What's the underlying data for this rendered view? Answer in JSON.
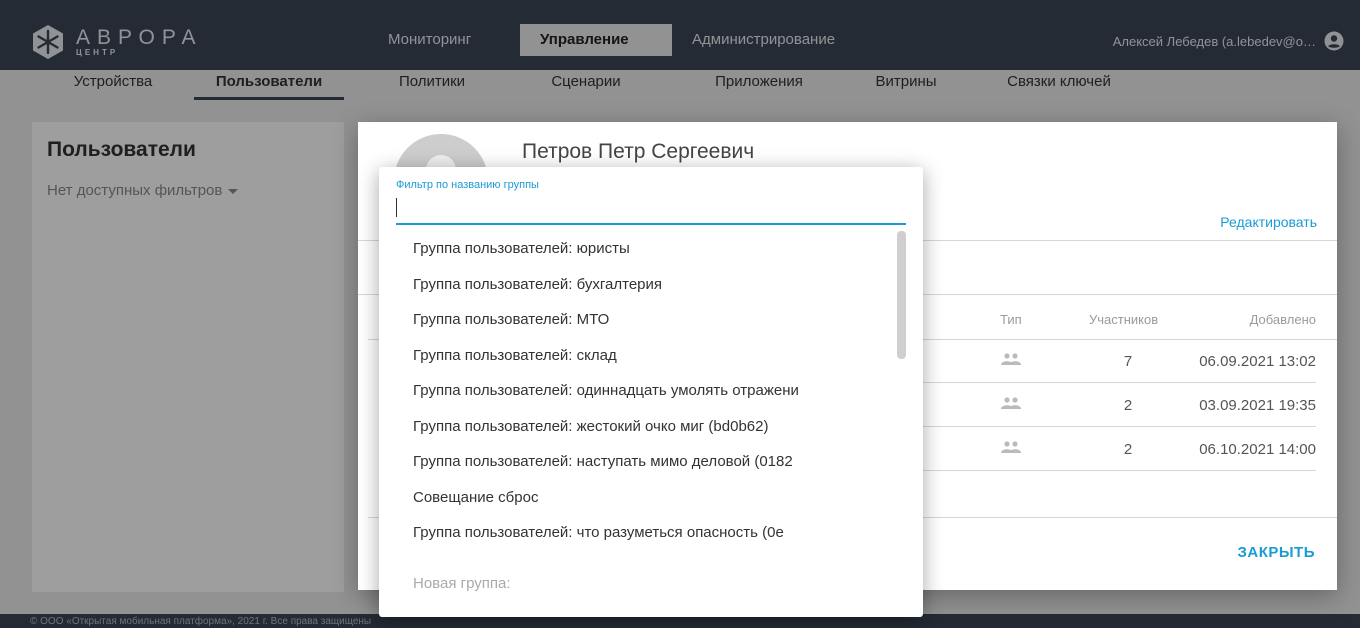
{
  "app": {
    "brand_name": "АВРОРА",
    "brand_sub": "ЦЕНТР",
    "main_tabs": [
      {
        "label": "Мониторинг"
      },
      {
        "label": "Управление"
      },
      {
        "label": "Администрирование"
      }
    ],
    "active_main_tab": "Управление",
    "user_label": "Алексей Лебедев (a.lebedev@o…"
  },
  "subnav": {
    "items": [
      {
        "label": "Устройства"
      },
      {
        "label": "Пользователи"
      },
      {
        "label": "Политики"
      },
      {
        "label": "Сценарии"
      },
      {
        "label": "Приложения"
      },
      {
        "label": "Витрины"
      },
      {
        "label": "Связки ключей"
      }
    ],
    "active": "Пользователи"
  },
  "left_panel": {
    "title": "Пользователи",
    "filter_label": "Нет доступных фильтров"
  },
  "dialog": {
    "user_name": "Петров Петр Сергеевич",
    "edit_label": "Редактировать",
    "columns": {
      "type": "Тип",
      "members": "Участников",
      "added": "Добавлено"
    },
    "rows": [
      {
        "type_icon": "group-icon",
        "members": "7",
        "added": "06.09.2021 13:02"
      },
      {
        "type_icon": "group-icon",
        "members": "2",
        "added": "03.09.2021 19:35"
      },
      {
        "type_icon": "group-icon",
        "members": "2",
        "added": "06.10.2021 14:00"
      }
    ],
    "close_label": "ЗАКРЫТЬ"
  },
  "dropdown": {
    "filter_label": "Фильтр по названию группы",
    "filter_value": "",
    "items": [
      "Группа пользователей: юристы",
      "Группа пользователей: бухгалтерия",
      "Группа пользователей: МТО",
      "Группа пользователей: склад",
      "Группа пользователей: одиннадцать умолять отражени",
      "Группа пользователей: жестокий очко миг (bd0b62)",
      "Группа пользователей: наступать мимо деловой (0182",
      "Совещание сброс",
      "Группа пользователей: что разуметься опасность (0e"
    ],
    "new_group_label": "Новая группа:"
  },
  "footer": {
    "text": "© ООО «Открытая мобильная платформа», 2021 г. Все права защищены"
  },
  "colors": {
    "header_bg": "#3b4656",
    "accent": "#1a9bd4",
    "page_bg": "#ececec"
  }
}
